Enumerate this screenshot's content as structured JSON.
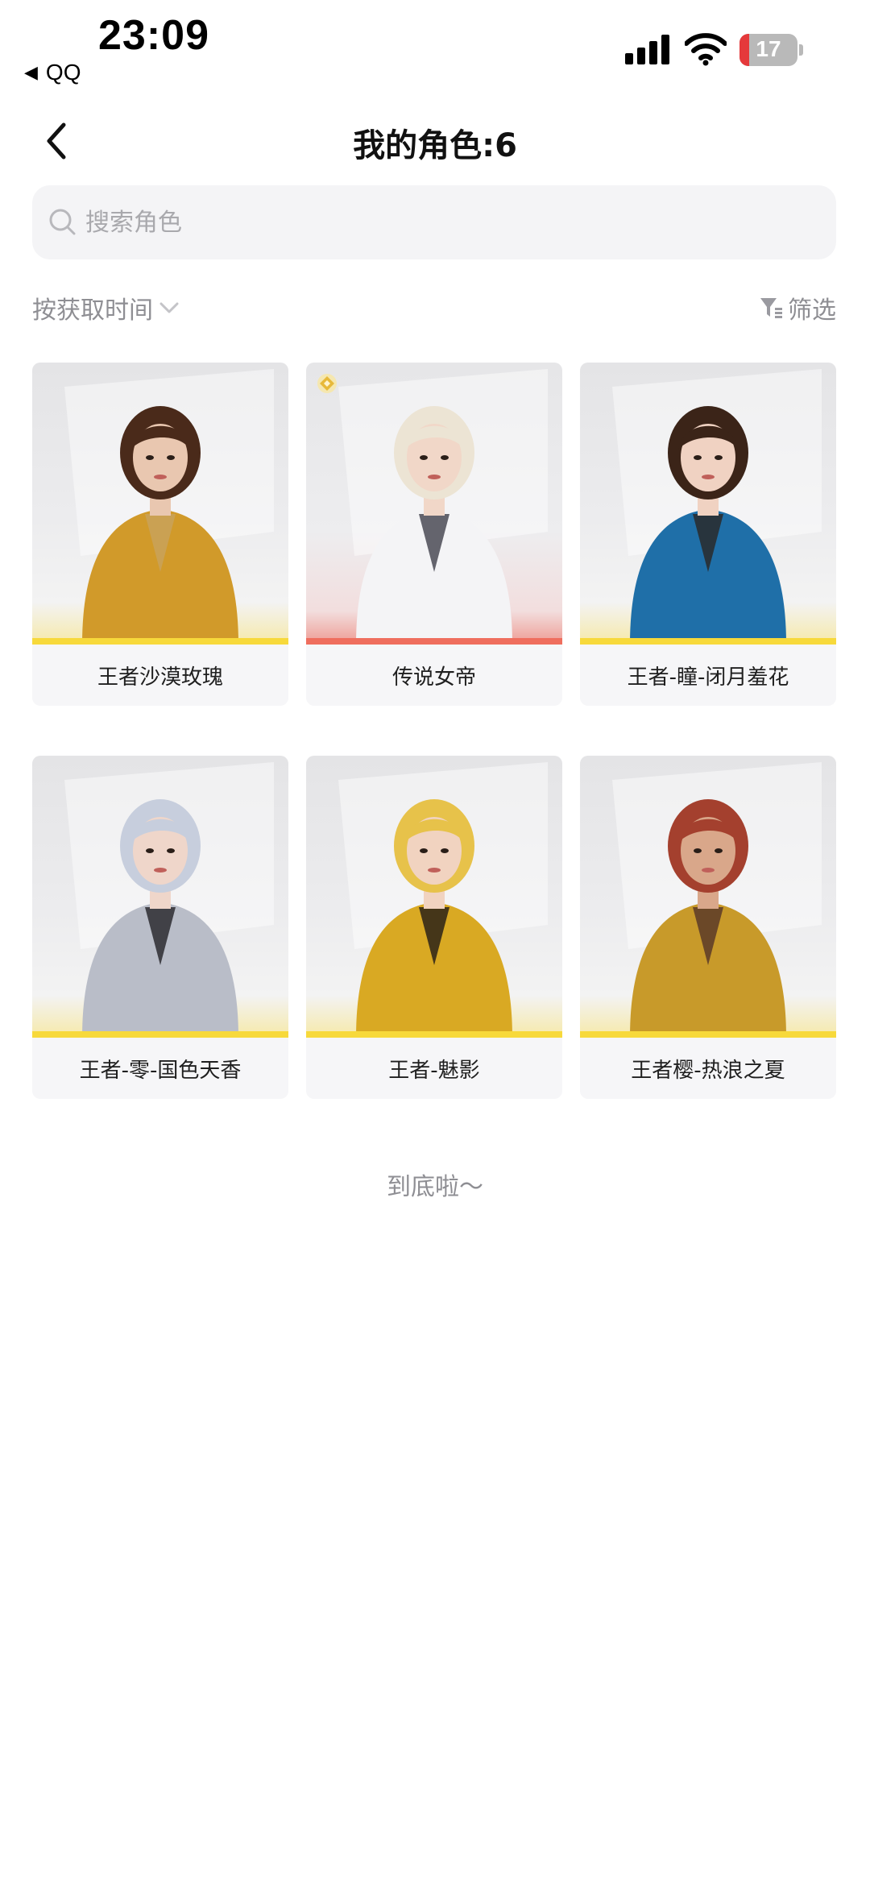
{
  "status_bar": {
    "time": "23:09",
    "back_app": "QQ",
    "battery": "17"
  },
  "header": {
    "title": "我的角色:6"
  },
  "search": {
    "placeholder": "搜索角色"
  },
  "toolbar": {
    "sort_label": "按获取时间",
    "filter_label": "筛选"
  },
  "characters": [
    {
      "name": "王者沙漠玫瑰",
      "tier": "king",
      "hair": "#4a2a1a",
      "skin": "#e9c7b0",
      "outfit": "#d19a2a",
      "accent": "#c9a25a"
    },
    {
      "name": "传说女帝",
      "tier": "legend",
      "hair": "#ece4d4",
      "skin": "#f1d7c8",
      "outfit": "#f4f4f6",
      "accent": "#4a4a55"
    },
    {
      "name": "王者-瞳-闭月羞花",
      "tier": "king",
      "hair": "#3b2418",
      "skin": "#f0d2c2",
      "outfit": "#1f6fa8",
      "accent": "#2a2a2a"
    },
    {
      "name": "王者-零-国色天香",
      "tier": "king",
      "hair": "#c7cedd",
      "skin": "#efd6ca",
      "outfit": "#b9bdc8",
      "accent": "#2b2b30"
    },
    {
      "name": "王者-魅影",
      "tier": "king",
      "hair": "#e7c24a",
      "skin": "#f1d3c0",
      "outfit": "#d9a923",
      "accent": "#2a2218"
    },
    {
      "name": "王者樱-热浪之夏",
      "tier": "king",
      "hair": "#a4402e",
      "skin": "#d9a78a",
      "outfit": "#c89a2a",
      "accent": "#5a3a28"
    }
  ],
  "footer": {
    "end_text": "到底啦～"
  }
}
